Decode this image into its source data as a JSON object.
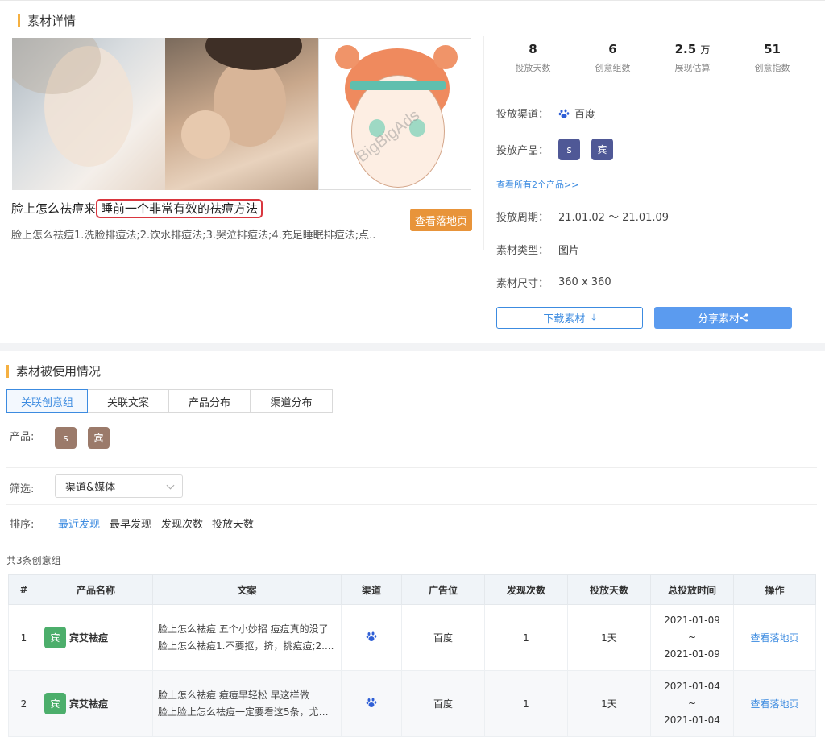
{
  "detail": {
    "section_title": "素材详情",
    "title_prefix": "脸上怎么祛痘来",
    "title_highlight": "睡前一个非常有效的祛痘方法",
    "description": "脸上怎么祛痘1.洗脸排痘法;2.饮水排痘法;3.哭泣排痘法;4.充足睡眠排痘法;点..",
    "landing_button": "查看落地页",
    "watermark": "BigBigAds",
    "stats": [
      {
        "value": "8",
        "unit": "",
        "label": "投放天数"
      },
      {
        "value": "6",
        "unit": "",
        "label": "创意组数"
      },
      {
        "value": "2.5",
        "unit": "万",
        "label": "展现估算"
      },
      {
        "value": "51",
        "unit": "",
        "label": "创意指数"
      }
    ],
    "channel_label": "投放渠道：",
    "channel_value": "百度",
    "product_label": "投放产品：",
    "product_chips": [
      "s",
      "宾"
    ],
    "view_all_products": "查看所有2个产品>>",
    "period_label": "投放周期：",
    "period_value": "21.01.02 ～ 21.01.09",
    "type_label": "素材类型：",
    "type_value": "图片",
    "size_label": "素材尺寸：",
    "size_value": "360 x 360",
    "download_button": "下载素材",
    "share_button": "分享素材"
  },
  "usage": {
    "section_title": "素材被使用情况",
    "tabs": [
      "关联创意组",
      "关联文案",
      "产品分布",
      "渠道分布"
    ],
    "product_label": "产品:",
    "product_chips": [
      "s",
      "宾"
    ],
    "filter_label": "筛选:",
    "filter_value": "渠道&媒体",
    "sort_label": "排序:",
    "sort_options": [
      "最近发现",
      "最早发现",
      "发现次数",
      "投放天数"
    ],
    "count_text": "共3条创意组",
    "table": {
      "headers": [
        "#",
        "产品名称",
        "文案",
        "渠道",
        "广告位",
        "发现次数",
        "投放天数",
        "总投放时间",
        "操作"
      ],
      "rows": [
        {
          "index": "1",
          "product_chip": "宾",
          "product_name": "宾艾祛痘",
          "copy_line1": "脸上怎么祛痘 五个小妙招 痘痘真的没了",
          "copy_line2": "脸上怎么祛痘1.不要抠，挤，挑痘痘;2....",
          "placement": "百度",
          "finds": "1",
          "days": "1天",
          "time_start": "2021-01-09",
          "time_sep": "~",
          "time_end": "2021-01-09",
          "action": "查看落地页"
        },
        {
          "index": "2",
          "product_chip": "宾",
          "product_name": "宾艾祛痘",
          "copy_line1": "脸上怎么祛痘 痘痘早轻松 早这样做",
          "copy_line2": "脸上脸上怎么祛痘一定要看这5条，尤其...",
          "placement": "百度",
          "finds": "1",
          "days": "1天",
          "time_start": "2021-01-04",
          "time_sep": "~",
          "time_end": "2021-01-04",
          "action": "查看落地页"
        }
      ]
    }
  },
  "colors": {
    "accent": "#3c8be0",
    "section_bar": "#f5b041",
    "landing_button": "#e8943a",
    "highlight_border": "#d9363e"
  }
}
